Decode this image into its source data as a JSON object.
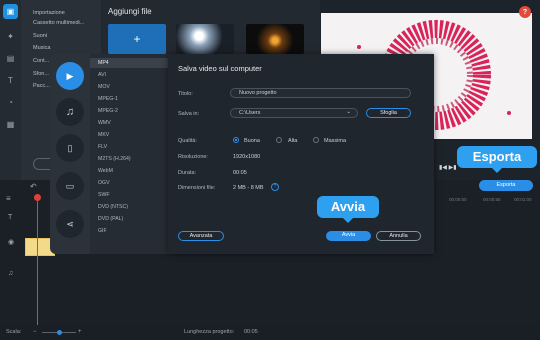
{
  "media": {
    "title": "Aggiungi file"
  },
  "sidebar": {
    "items": [
      "Importazione",
      "Cassetto multimedi...",
      "Suoni",
      "Musica",
      "Cont...",
      "Sfon...",
      "Pacc..."
    ]
  },
  "formats": [
    "MP4",
    "AVI",
    "MOV",
    "MPEG-1",
    "MPEG-2",
    "WMV",
    "MKV",
    "FLV",
    "M2TS (H.264)",
    "WebM",
    "OGV",
    "SWF",
    "DVD (NTSC)",
    "DVD (PAL)",
    "GIF"
  ],
  "dialog": {
    "title": "Salva video sul computer",
    "title_label": "Titolo:",
    "title_value": "Nuovo progetto",
    "save_label": "Salva in:",
    "save_value": "C:\\Users",
    "browse": "Sfoglia",
    "quality_label": "Qualità:",
    "quality_options": [
      "Buona",
      "Alta",
      "Massima"
    ],
    "resolution_label": "Risoluzione:",
    "resolution_value": "1920x1080",
    "duration_label": "Durata:",
    "duration_value": "00:05",
    "size_label": "Dimensioni file:",
    "size_value": "2 MB - 8 MB",
    "advanced": "Avanzata",
    "start": "Avvia",
    "cancel": "Annulla"
  },
  "callouts": {
    "export": "Esporta",
    "start": "Avvia"
  },
  "export_button": "Esporta",
  "timeline": {
    "ticks": [
      "00:00:50",
      "00:00:55",
      "00:01:00"
    ]
  },
  "status": {
    "scale_label": "Scala:",
    "project_length_label": "Lunghezza progetto:",
    "project_length_value": "00:05"
  }
}
